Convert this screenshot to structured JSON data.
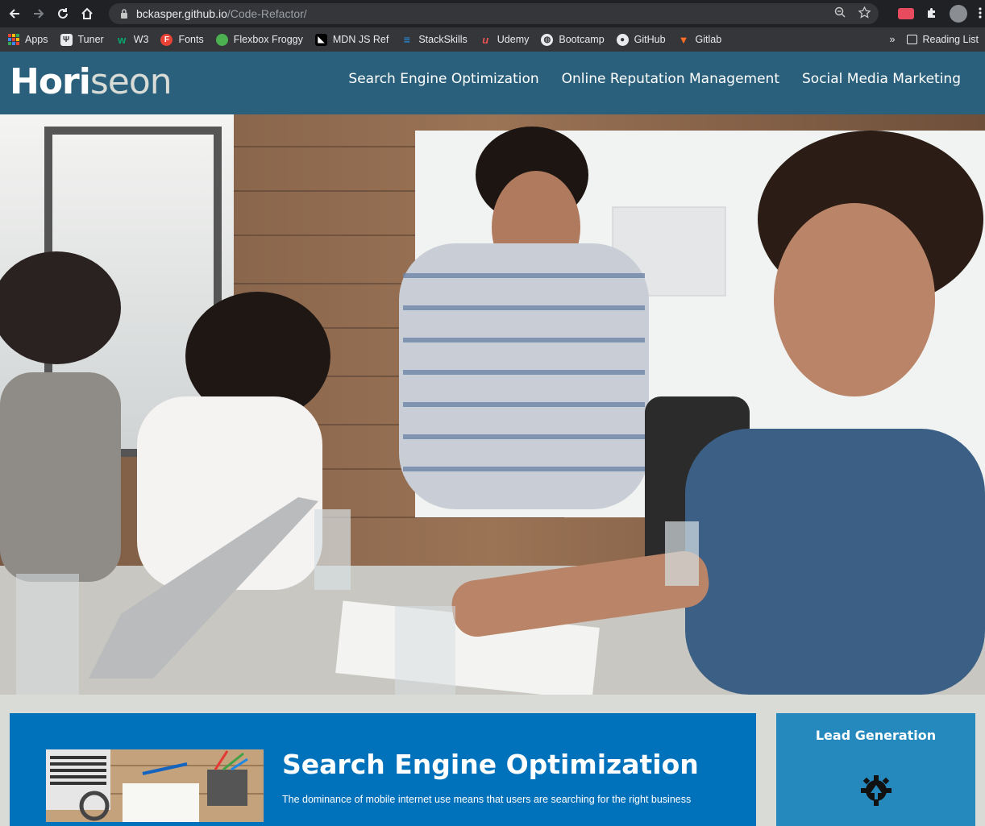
{
  "browser": {
    "url_host": "bckasper.github.io",
    "url_path": "/Code-Refactor/",
    "bookmarks": [
      {
        "label": "Apps",
        "icon": "apps-grid-icon"
      },
      {
        "label": "Tuner",
        "icon": "tuner-icon"
      },
      {
        "label": "W3",
        "icon": "w3-icon"
      },
      {
        "label": "Fonts",
        "icon": "fonts-icon"
      },
      {
        "label": "Flexbox Froggy",
        "icon": "frog-icon"
      },
      {
        "label": "MDN JS Ref",
        "icon": "mdn-icon"
      },
      {
        "label": "StackSkills",
        "icon": "stackskills-icon"
      },
      {
        "label": "Udemy",
        "icon": "udemy-icon"
      },
      {
        "label": "Bootcamp",
        "icon": "globe-icon"
      },
      {
        "label": "GitHub",
        "icon": "github-icon"
      },
      {
        "label": "Gitlab",
        "icon": "gitlab-icon"
      }
    ],
    "overflow_label": "»",
    "reading_list_label": "Reading List"
  },
  "site": {
    "logo_main": "Hori",
    "logo_accent": "seon",
    "nav": [
      {
        "label": "Search Engine Optimization"
      },
      {
        "label": "Online Reputation Management"
      },
      {
        "label": "Social Media Marketing"
      }
    ],
    "seo": {
      "title": "Search Engine Optimization",
      "text": "The dominance of mobile internet use means that users are searching for the right business"
    },
    "aside": {
      "title": "Lead Generation"
    }
  },
  "colors": {
    "header_bg": "#2a607c",
    "content_bg": "#0072bb",
    "aside_bg": "#2589bd",
    "page_bg": "#d9dcd6"
  }
}
